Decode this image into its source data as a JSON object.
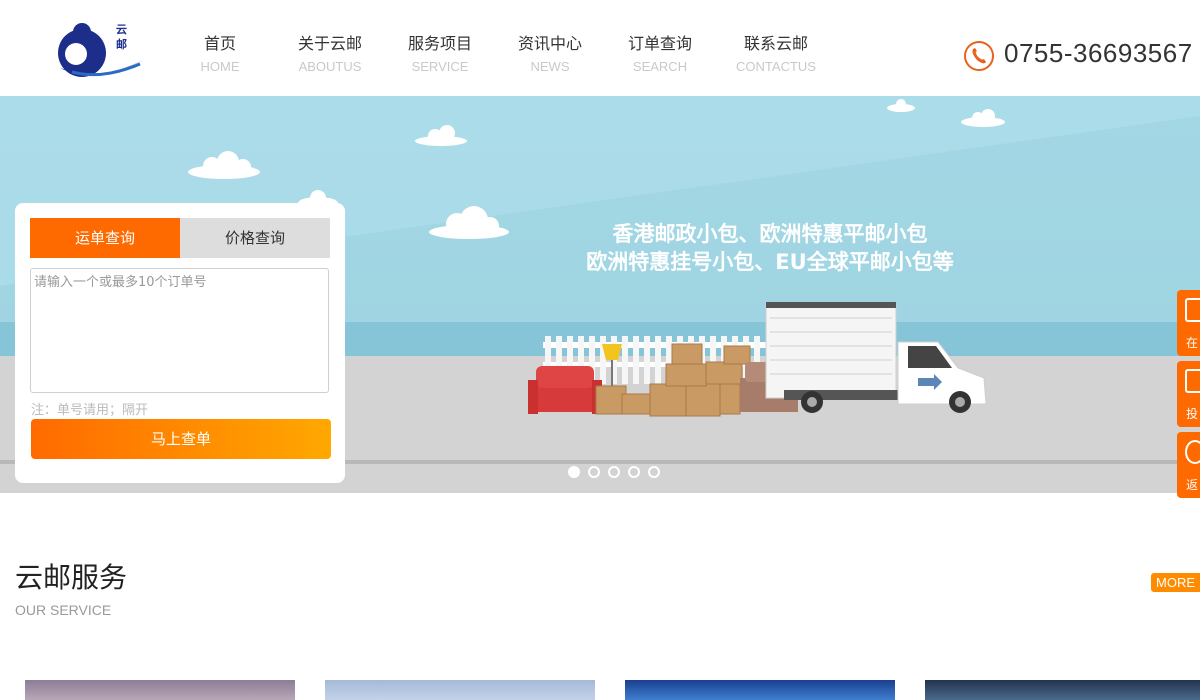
{
  "header": {
    "logo_text": "云邮",
    "nav": [
      {
        "cn": "首页",
        "en": "HOME"
      },
      {
        "cn": "关于云邮",
        "en": "ABOUTUS"
      },
      {
        "cn": "服务项目",
        "en": "SERVICE"
      },
      {
        "cn": "资讯中心",
        "en": "NEWS"
      },
      {
        "cn": "订单查询",
        "en": "SEARCH"
      },
      {
        "cn": "联系云邮",
        "en": "CONTACTUS"
      }
    ],
    "phone": "0755-36693567"
  },
  "banner": {
    "slogan_line1": "香港邮政小包、欧洲特惠平邮小包",
    "slogan_line2": "欧洲特惠挂号小包、EU全球平邮小包等",
    "dots_count": 5,
    "active_dot": 1
  },
  "query": {
    "tab_waybill": "运单查询",
    "tab_price": "价格查询",
    "placeholder": "请输入一个或最多10个订单号",
    "note": "注：单号请用；隔开",
    "button": "马上查单"
  },
  "side_float": [
    {
      "label": "在",
      "icon": "phone-card-icon"
    },
    {
      "label": "投",
      "icon": "mail-icon"
    },
    {
      "label": "返",
      "icon": "top-icon"
    }
  ],
  "service": {
    "title": "云邮服务",
    "subtitle": "OUR SERVICE",
    "more": "MORE"
  },
  "colors": {
    "accent": "#ff6a00",
    "sky": "#a5d9e6",
    "ground": "#d2d2d2"
  }
}
